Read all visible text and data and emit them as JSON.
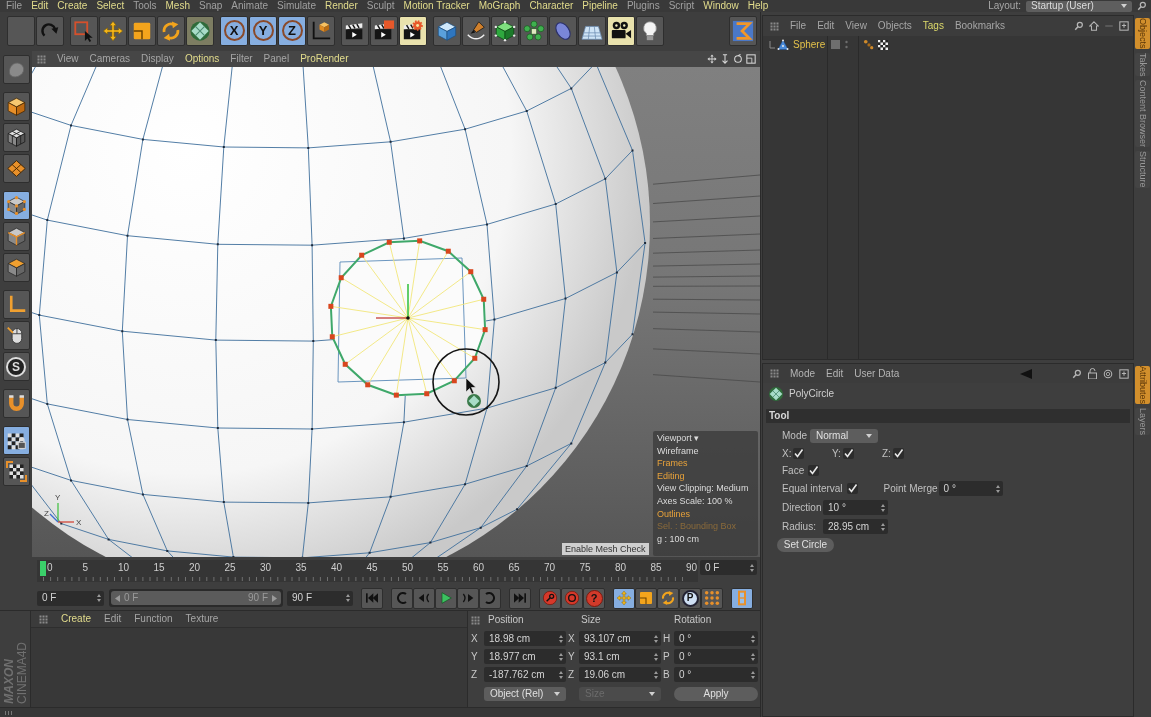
{
  "menu_bar": {
    "items": [
      {
        "label": "File",
        "highlighted": false
      },
      {
        "label": "Edit",
        "highlighted": true
      },
      {
        "label": "Create",
        "highlighted": true
      },
      {
        "label": "Select",
        "highlighted": true
      },
      {
        "label": "Tools",
        "highlighted": false
      },
      {
        "label": "Mesh",
        "highlighted": true
      },
      {
        "label": "Snap",
        "highlighted": false
      },
      {
        "label": "Animate",
        "highlighted": false
      },
      {
        "label": "Simulate",
        "highlighted": false
      },
      {
        "label": "Render",
        "highlighted": true
      },
      {
        "label": "Sculpt",
        "highlighted": false
      },
      {
        "label": "Motion Tracker",
        "highlighted": true
      },
      {
        "label": "MoGraph",
        "highlighted": true
      },
      {
        "label": "Character",
        "highlighted": true
      },
      {
        "label": "Pipeline",
        "highlighted": true
      },
      {
        "label": "Plugins",
        "highlighted": false
      },
      {
        "label": "Script",
        "highlighted": false
      },
      {
        "label": "Window",
        "highlighted": true
      },
      {
        "label": "Help",
        "highlighted": true
      }
    ],
    "layout_label": "Layout:",
    "layout_value": "Startup (User)"
  },
  "toolbar": [
    [
      {
        "kind": "undo",
        "selected": false
      },
      {
        "kind": "redo",
        "selected": false
      }
    ],
    [
      {
        "kind": "live_selection",
        "selected": false
      },
      {
        "kind": "move",
        "selected": false
      },
      {
        "kind": "scale",
        "selected": false
      },
      {
        "kind": "rotate",
        "selected": false
      },
      {
        "kind": "polycircle",
        "selected": true
      }
    ],
    [
      {
        "kind": "axis",
        "label": "X",
        "selected": true
      },
      {
        "kind": "axis",
        "label": "Y",
        "selected": true
      },
      {
        "kind": "axis",
        "label": "Z",
        "selected": true
      },
      {
        "kind": "coordinate_system",
        "selected": false
      }
    ],
    [
      {
        "kind": "render_view",
        "selected": false
      },
      {
        "kind": "render_picture",
        "selected": false
      },
      {
        "kind": "render_settings",
        "selected": true
      }
    ],
    [
      {
        "kind": "cube",
        "selected": false
      },
      {
        "kind": "pen",
        "selected": false
      },
      {
        "kind": "subdivision",
        "selected": false
      },
      {
        "kind": "cloner",
        "selected": false
      },
      {
        "kind": "deformer",
        "selected": false
      },
      {
        "kind": "floor",
        "selected": false
      },
      {
        "kind": "camera",
        "selected": true
      },
      {
        "kind": "light",
        "selected": false
      }
    ],
    [
      {
        "kind": "layout_switch",
        "selected": false
      }
    ]
  ],
  "left_toolbar": [
    [
      {
        "kind": "sculpt",
        "selected": false
      }
    ],
    [
      {
        "kind": "model",
        "selected": false
      },
      {
        "kind": "texture",
        "selected": false
      },
      {
        "kind": "workplane",
        "selected": false
      }
    ],
    [
      {
        "kind": "points",
        "selected": true
      },
      {
        "kind": "edges",
        "selected": false
      },
      {
        "kind": "polygons",
        "selected": false
      }
    ],
    [
      {
        "kind": "axis_mode",
        "selected": false
      },
      {
        "kind": "tweak",
        "selected": false
      },
      {
        "kind": "snap",
        "label": "S",
        "selected": false
      }
    ],
    [
      {
        "kind": "magnet",
        "selected": false
      }
    ],
    [
      {
        "kind": "lock_workplane",
        "selected": true
      },
      {
        "kind": "planar_workplane",
        "selected": false
      }
    ]
  ],
  "viewport": {
    "menu": [
      {
        "label": "View",
        "highlighted": false
      },
      {
        "label": "Cameras",
        "highlighted": false
      },
      {
        "label": "Display",
        "highlighted": false
      },
      {
        "label": "Options",
        "highlighted": true
      },
      {
        "label": "Filter",
        "highlighted": false
      },
      {
        "label": "Panel",
        "highlighted": false
      },
      {
        "label": "ProRender",
        "highlighted": true
      }
    ],
    "axis_labels": [
      "Y",
      "X",
      "Z"
    ],
    "hud": [
      {
        "text": "Viewport ▾",
        "kind": "plain"
      },
      {
        "text": "Wireframe",
        "kind": "plain"
      },
      {
        "text": "Frames",
        "kind": "active"
      },
      {
        "text": "Editing",
        "kind": "active"
      },
      {
        "text": "View Clipping:  Medium",
        "kind": "plain"
      },
      {
        "text": "Axes Scale:   100 %",
        "kind": "plain"
      },
      {
        "text": "Outlines",
        "kind": "active"
      },
      {
        "text": "Sel. : Bounding Box",
        "kind": "dim"
      },
      {
        "text": "g : 100 cm",
        "kind": "plain"
      }
    ],
    "tooltip": "Enable Mesh Check"
  },
  "timeline": {
    "ticks": [
      "0",
      "5",
      "10",
      "15",
      "20",
      "25",
      "30",
      "35",
      "40",
      "45",
      "50",
      "55",
      "60",
      "65",
      "70",
      "75",
      "80",
      "85",
      "90"
    ],
    "playhead": {
      "level": 0
    },
    "current_frame": "0 F"
  },
  "transport": {
    "start_field": "0 F",
    "range": {
      "start": "0 F",
      "end": "90 F",
      "level": 1
    },
    "end_field": "90 F",
    "buttons": [
      [
        {
          "kind": "go_start",
          "selected": false
        }
      ],
      [
        {
          "kind": "prev_key",
          "selected": false
        },
        {
          "kind": "prev_frame",
          "selected": false
        },
        {
          "kind": "play",
          "selected": false
        },
        {
          "kind": "next_frame",
          "selected": false
        },
        {
          "kind": "next_key",
          "selected": false
        }
      ],
      [
        {
          "kind": "go_end",
          "selected": false
        }
      ],
      [
        {
          "kind": "record",
          "selected": false
        },
        {
          "kind": "autokey",
          "selected": false
        },
        {
          "kind": "key_selection",
          "label": "?",
          "selected": false
        }
      ],
      [
        {
          "kind": "move_key",
          "selected": true
        },
        {
          "kind": "scale_key",
          "selected": false
        },
        {
          "kind": "rotate_key",
          "selected": false
        },
        {
          "kind": "param_key",
          "label": "P",
          "selected": false
        },
        {
          "kind": "point_key",
          "selected": false
        }
      ],
      [
        {
          "kind": "timeline_view",
          "selected": true
        }
      ]
    ]
  },
  "logo": {
    "brand": "MAXON",
    "product": "CINEMA4D"
  },
  "material_manager": {
    "menu": [
      {
        "label": "Create",
        "highlighted": true
      },
      {
        "label": "Edit",
        "highlighted": false
      },
      {
        "label": "Function",
        "highlighted": false
      },
      {
        "label": "Texture",
        "highlighted": false
      }
    ]
  },
  "coordinates": {
    "headers": [
      "Position",
      "Size",
      "Rotation"
    ],
    "rows": [
      {
        "position": {
          "axis": "X",
          "value": "18.98 cm"
        },
        "size": {
          "axis": "X",
          "value": "93.107 cm"
        },
        "rotation": {
          "axis": "H",
          "value": "0 °"
        }
      },
      {
        "position": {
          "axis": "Y",
          "value": "18.977 cm"
        },
        "size": {
          "axis": "Y",
          "value": "93.1 cm"
        },
        "rotation": {
          "axis": "P",
          "value": "0 °"
        }
      },
      {
        "position": {
          "axis": "Z",
          "value": "-187.762 cm"
        },
        "size": {
          "axis": "Z",
          "value": "19.06 cm"
        },
        "rotation": {
          "axis": "B",
          "value": "0 °"
        }
      }
    ],
    "mode": "Object (Rel)",
    "size_mode": {
      "label": "Size",
      "disabled": true
    },
    "apply": "Apply"
  },
  "object_manager": {
    "menu": [
      {
        "label": "File",
        "highlighted": false
      },
      {
        "label": "Edit",
        "highlighted": false
      },
      {
        "label": "View",
        "highlighted": false
      },
      {
        "label": "Objects",
        "highlighted": false
      },
      {
        "label": "Tags",
        "highlighted": true
      },
      {
        "label": "Bookmarks",
        "highlighted": false
      }
    ],
    "objects": [
      {
        "name": "Sphere",
        "selected": true
      }
    ]
  },
  "side_tabs_top": [
    {
      "label": "Objects",
      "selected": true
    },
    {
      "label": "Takes",
      "selected": false
    },
    {
      "label": "Content Browser",
      "selected": false
    },
    {
      "label": "Structure",
      "selected": false
    }
  ],
  "attributes": {
    "menu": [
      "Mode",
      "Edit",
      "User Data"
    ],
    "object_name": "PolyCircle",
    "section": "Tool",
    "mode": {
      "label": "Mode",
      "value": "Normal"
    },
    "axes": [
      {
        "label": "X:",
        "checked": true
      },
      {
        "label": "Y:",
        "checked": true
      },
      {
        "label": "Z:",
        "checked": true
      }
    ],
    "face": {
      "label": "Face",
      "checked": true
    },
    "equal_interval": {
      "label": "Equal interval",
      "checked": true
    },
    "point_merge": {
      "label": "Point Merge",
      "value": "0 °"
    },
    "direction": {
      "label": "Direction",
      "value": "10 °"
    },
    "radius": {
      "label": "Radius:",
      "value": "28.95 cm"
    },
    "action": "Set Circle"
  },
  "side_tabs_bottom": [
    {
      "label": "Attributes",
      "selected": true
    },
    {
      "label": "Layers",
      "selected": false
    }
  ]
}
